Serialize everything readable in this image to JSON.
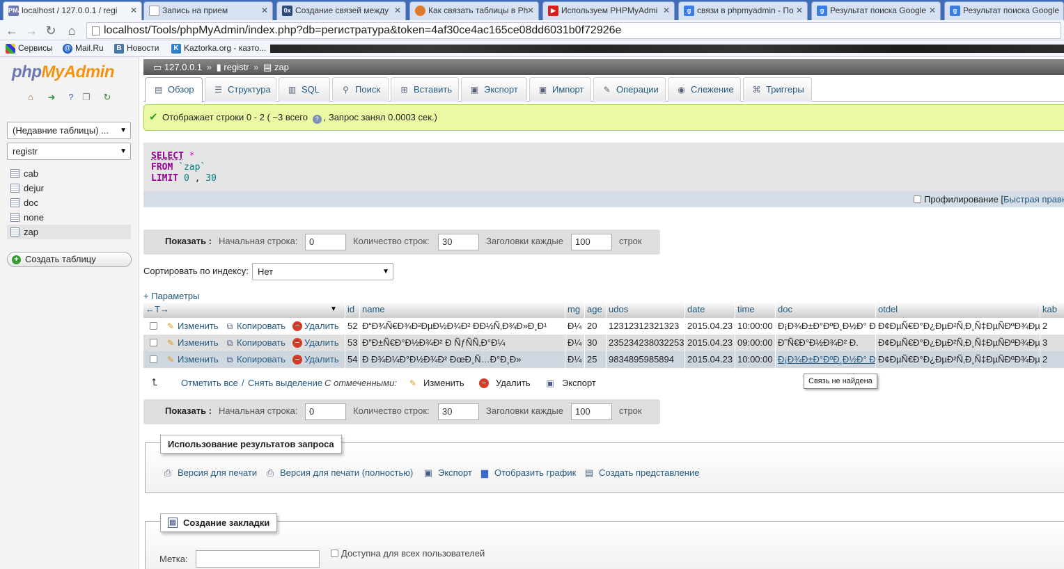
{
  "browser": {
    "tabs": [
      {
        "title": "localhost / 127.0.0.1 / regi",
        "favicon": "pma-icon",
        "active": true
      },
      {
        "title": "Запись на прием",
        "favicon": "page-icon"
      },
      {
        "title": "Создание связей между",
        "favicon": "ox-icon"
      },
      {
        "title": "Как связать таблицы в Ph",
        "favicon": "firefox-icon"
      },
      {
        "title": "Используем PHPMyAdmi",
        "favicon": "youtube-icon"
      },
      {
        "title": "связи в phpmyadmin - По",
        "favicon": "google-icon"
      },
      {
        "title": "Результат поиска Google",
        "favicon": "google-icon"
      },
      {
        "title": "Результат поиска Google",
        "favicon": "google-icon"
      }
    ],
    "address": "localhost/Tools/phpMyAdmin/index.php?db=регистратура&token=4af30ce4ac165ce08dd6031b0f72926e",
    "bookmarks": [
      {
        "label": "Сервисы",
        "icon": "apps-icon"
      },
      {
        "label": "Mail.Ru",
        "icon": "mailru-icon"
      },
      {
        "label": "Новости",
        "icon": "vk-icon"
      },
      {
        "label": "Kaztorka.org - казто...",
        "icon": "kaztorka-icon"
      }
    ]
  },
  "sidebar": {
    "logo_php": "php",
    "logo_myadmin": "MyAdmin",
    "recent_tables": "(Недавние таблицы) ...",
    "database_select": "registr",
    "tables": [
      "cab",
      "dejur",
      "doc",
      "none",
      "zap"
    ],
    "current_table": "zap",
    "create_table": "Создать таблицу"
  },
  "breadcrumb": {
    "server": "127.0.0.1",
    "sep1": "»",
    "database": "registr",
    "sep2": "»",
    "table": "zap"
  },
  "tabs": [
    {
      "label": "Обзор",
      "icon": "browse-icon"
    },
    {
      "label": "Структура",
      "icon": "structure-icon"
    },
    {
      "label": "SQL",
      "icon": "sql-icon"
    },
    {
      "label": "Поиск",
      "icon": "search-icon"
    },
    {
      "label": "Вставить",
      "icon": "insert-icon"
    },
    {
      "label": "Экспорт",
      "icon": "export-icon"
    },
    {
      "label": "Импорт",
      "icon": "import-icon"
    },
    {
      "label": "Операции",
      "icon": "operations-icon"
    },
    {
      "label": "Слежение",
      "icon": "tracking-icon"
    },
    {
      "label": "Триггеры",
      "icon": "triggers-icon"
    }
  ],
  "message": {
    "part1": "Отображает строки 0 - 2 ( ~3 всего",
    "part2": ", Запрос занял 0.0003 сек.)"
  },
  "sql": {
    "select_kw": "SELECT",
    "star": "*",
    "from_kw": "FROM",
    "table": "`zap`",
    "limit_kw": "LIMIT",
    "limit_start": "0",
    "comma": ",",
    "limit_count": "30"
  },
  "profiling": {
    "label": "Профилирование",
    "bracket": "[",
    "link": "Быстрая правка"
  },
  "pager": {
    "show_label": "Показать :",
    "start_label": "Начальная строка:",
    "start_value": "0",
    "rows_label": "Количество строк:",
    "rows_value": "30",
    "headers_label": "Заголовки каждые",
    "headers_value": "100",
    "rows_suffix": "строк"
  },
  "sort": {
    "label": "Сортировать по индексу:",
    "value": "Нет"
  },
  "params_link": "+ Параметры",
  "table": {
    "arrows": "←T→",
    "sort_marker": "▼",
    "columns": [
      "id",
      "name",
      "mg",
      "age",
      "udos",
      "date",
      "time",
      "doc",
      "otdel",
      "kab"
    ],
    "action_edit": "Изменить",
    "action_copy": "Копировать",
    "action_delete": "Удалить",
    "rows": [
      {
        "id": "52",
        "name": "Ð“Ð¾Ñ€Ð¾Ð²ÐµÐ½Ð¾Ð² ÐÐ½Ñ‚Ð¾Ð»Ð¸Ð¹",
        "mg": "Ð¼",
        "age": "20",
        "udos": "12312312321323",
        "date": "2015.04.23",
        "time": "10:00:00",
        "doc": "Ð¡Ð¾Ð±Ð°ÐºÐ¸Ð½Ð° Ð˜.",
        "otdel": "Ð¢ÐµÑ€Ð°Ð¿ÐµÐ²Ñ‚Ð¸Ñ‡ÐµÑÐºÐ¾Ðµ",
        "kab": "2"
      },
      {
        "id": "53",
        "name": "Ð”Ð±Ñ€Ð°Ð½Ð¾Ð² Ð ÑƒÑÑ‚Ð°Ð¼",
        "mg": "Ð¼",
        "age": "30",
        "udos": "235234238032253",
        "date": "2015.04.23",
        "time": "09:00:00",
        "doc": "Ð˜Ñ€Ð°Ð½Ð¾Ð² Ð.",
        "otdel": "Ð¢ÐµÑ€Ð°Ð¿ÐµÐ²Ñ‚Ð¸Ñ‡ÐµÑÐºÐ¾Ðµ",
        "kab": "3"
      },
      {
        "id": "54",
        "name": "Ð Ð¾Ð¼Ð°Ð½Ð¾Ð² ÐœÐ¸Ñ…Ð°Ð¸Ð»",
        "mg": "Ð¼",
        "age": "25",
        "udos": "9834895985894",
        "date": "2015.04.23",
        "time": "10:00:00",
        "doc": "Ð¡Ð¾Ð±Ð°ÐºÐ¸Ð½Ð° Ð˜.",
        "otdel": "Ð¢ÐµÑ€Ð°Ð¿ÐµÐ²Ñ‚Ð¸Ñ‡ÐµÑÐºÐ¾Ðµ",
        "kab": "2"
      }
    ],
    "tooltip": "Связь не найдена"
  },
  "bulk": {
    "check_all": "Отметить все",
    "slash": "/",
    "uncheck_all": "Снять выделение",
    "with_selected": "С отмеченными:",
    "edit": "Изменить",
    "delete": "Удалить",
    "export": "Экспорт"
  },
  "query_results": {
    "legend": "Использование результатов запроса",
    "actions": [
      {
        "label": "Версия для печати",
        "icon": "print-icon"
      },
      {
        "label": "Версия для печати (полностью)",
        "icon": "print-icon"
      },
      {
        "label": "Экспорт",
        "icon": "export-icon"
      },
      {
        "label": "Отобразить график",
        "icon": "chart-icon"
      },
      {
        "label": "Создать представление",
        "icon": "view-icon"
      }
    ]
  },
  "bookmark": {
    "legend": "Создание закладки",
    "label_field": "Метка:",
    "public_label": "Доступна для всех пользователей"
  },
  "colors": {
    "link": "#235a81",
    "success_bg": "#ebf8a4",
    "keyword": "#990099",
    "logo_php": "#6c78af",
    "logo_myadmin": "#f29412"
  }
}
